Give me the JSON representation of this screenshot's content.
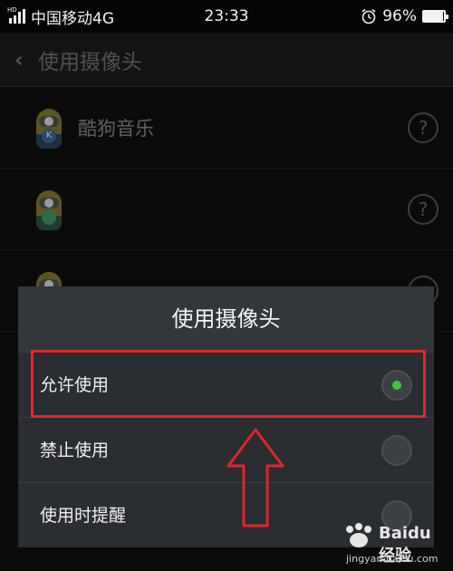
{
  "status_bar": {
    "signal_tag": "HD",
    "carrier": "中国移动4G",
    "time": "23:33",
    "battery_percent": "96%",
    "battery_level": 0.96,
    "alarm_icon": "alarm-clock-icon",
    "signal_icon": "cellular-signal-icon"
  },
  "header": {
    "back_icon": "chevron-left-icon",
    "title": "使用摄像头"
  },
  "app_list": [
    {
      "name": "酷狗音乐",
      "badge": "K",
      "status_icon": "question-icon",
      "status_glyph": "?"
    },
    {
      "name": "",
      "badge": "",
      "status_icon": "question-icon",
      "status_glyph": "?"
    },
    {
      "name": "",
      "badge": "",
      "status_icon": "check-icon",
      "status_glyph": "✓"
    }
  ],
  "dialog": {
    "title": "使用摄像头",
    "options": [
      {
        "label": "允许使用",
        "selected": true
      },
      {
        "label": "禁止使用",
        "selected": false
      },
      {
        "label": "使用时提醒",
        "selected": false
      }
    ],
    "selected_color": "#3cc93c"
  },
  "annotation": {
    "color": "#e0262a",
    "arrow_icon": "up-arrow-icon"
  },
  "watermark": {
    "logo_icon": "baidu-paw-icon",
    "name": "Baidu 经验",
    "url": "jingyan.baidu.com"
  }
}
